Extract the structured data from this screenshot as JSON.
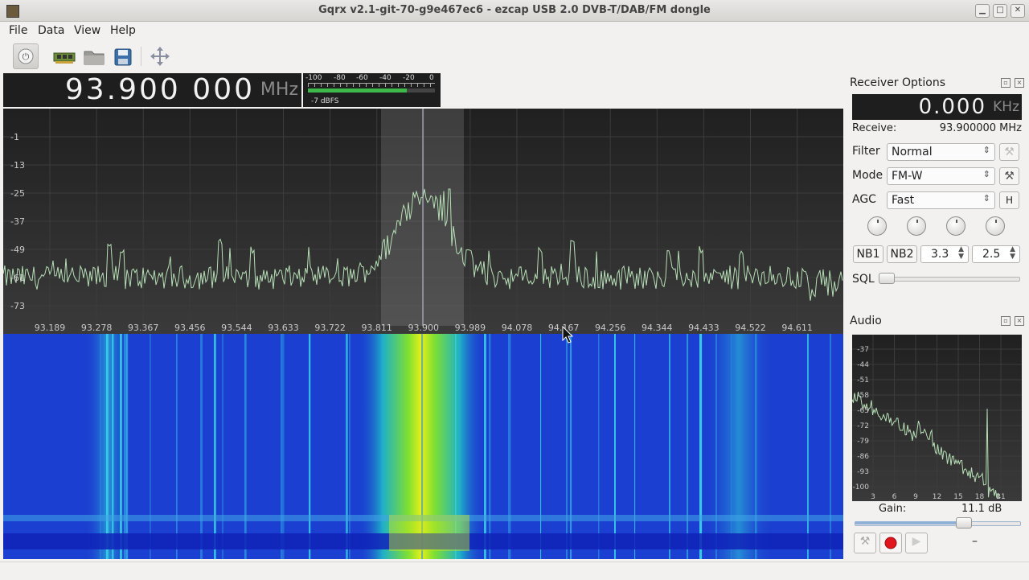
{
  "window": {
    "title": "Gqrx v2.1-git-70-g9e467ec6 - ezcap USB 2.0 DVB-T/DAB/FM dongle"
  },
  "menu": {
    "file": "File",
    "data": "Data",
    "view": "View",
    "help": "Help"
  },
  "toolbar": {
    "power": "⏻"
  },
  "frequency": {
    "value": "93.900 000",
    "unit": "MHz"
  },
  "meter": {
    "scale": [
      "-100",
      "-80",
      "-60",
      "-40",
      "-20",
      "0"
    ],
    "level_label": "-7 dBFS",
    "level_fraction": 0.78
  },
  "spectrum": {
    "y_ticks": [
      "-1",
      "-13",
      "-25",
      "-37",
      "-49",
      "-61",
      "-73"
    ],
    "x_ticks": [
      "93.189",
      "93.278",
      "93.367",
      "93.456",
      "93.544",
      "93.633",
      "93.722",
      "93.811",
      "93.900",
      "93.989",
      "94.078",
      "94.167",
      "94.256",
      "94.344",
      "94.433",
      "94.522",
      "94.611"
    ],
    "center": "93.900"
  },
  "receiver": {
    "title": "Receiver Options",
    "offset_value": "0.000",
    "offset_unit": "KHz",
    "receive_label": "Receive:",
    "receive_value": "93.900000 MHz",
    "filter_label": "Filter",
    "filter_value": "Normal",
    "mode_label": "Mode",
    "mode_value": "FM-W",
    "agc_label": "AGC",
    "agc_value": "Fast",
    "agc_h": "H",
    "nb1": "NB1",
    "nb2": "NB2",
    "nb1_value": "3.3",
    "nb2_value": "2.5",
    "sql_label": "SQL"
  },
  "audio": {
    "title": "Audio",
    "y_ticks": [
      "-37",
      "-44",
      "-51",
      "-58",
      "-65",
      "-72",
      "-79",
      "-86",
      "-93",
      "-100"
    ],
    "x_ticks": [
      "3",
      "6",
      "9",
      "12",
      "15",
      "18",
      "21"
    ],
    "gain_label": "Gain:",
    "gain_value": "11.1 dB",
    "gain_fraction": 0.66,
    "extra": "–"
  }
}
